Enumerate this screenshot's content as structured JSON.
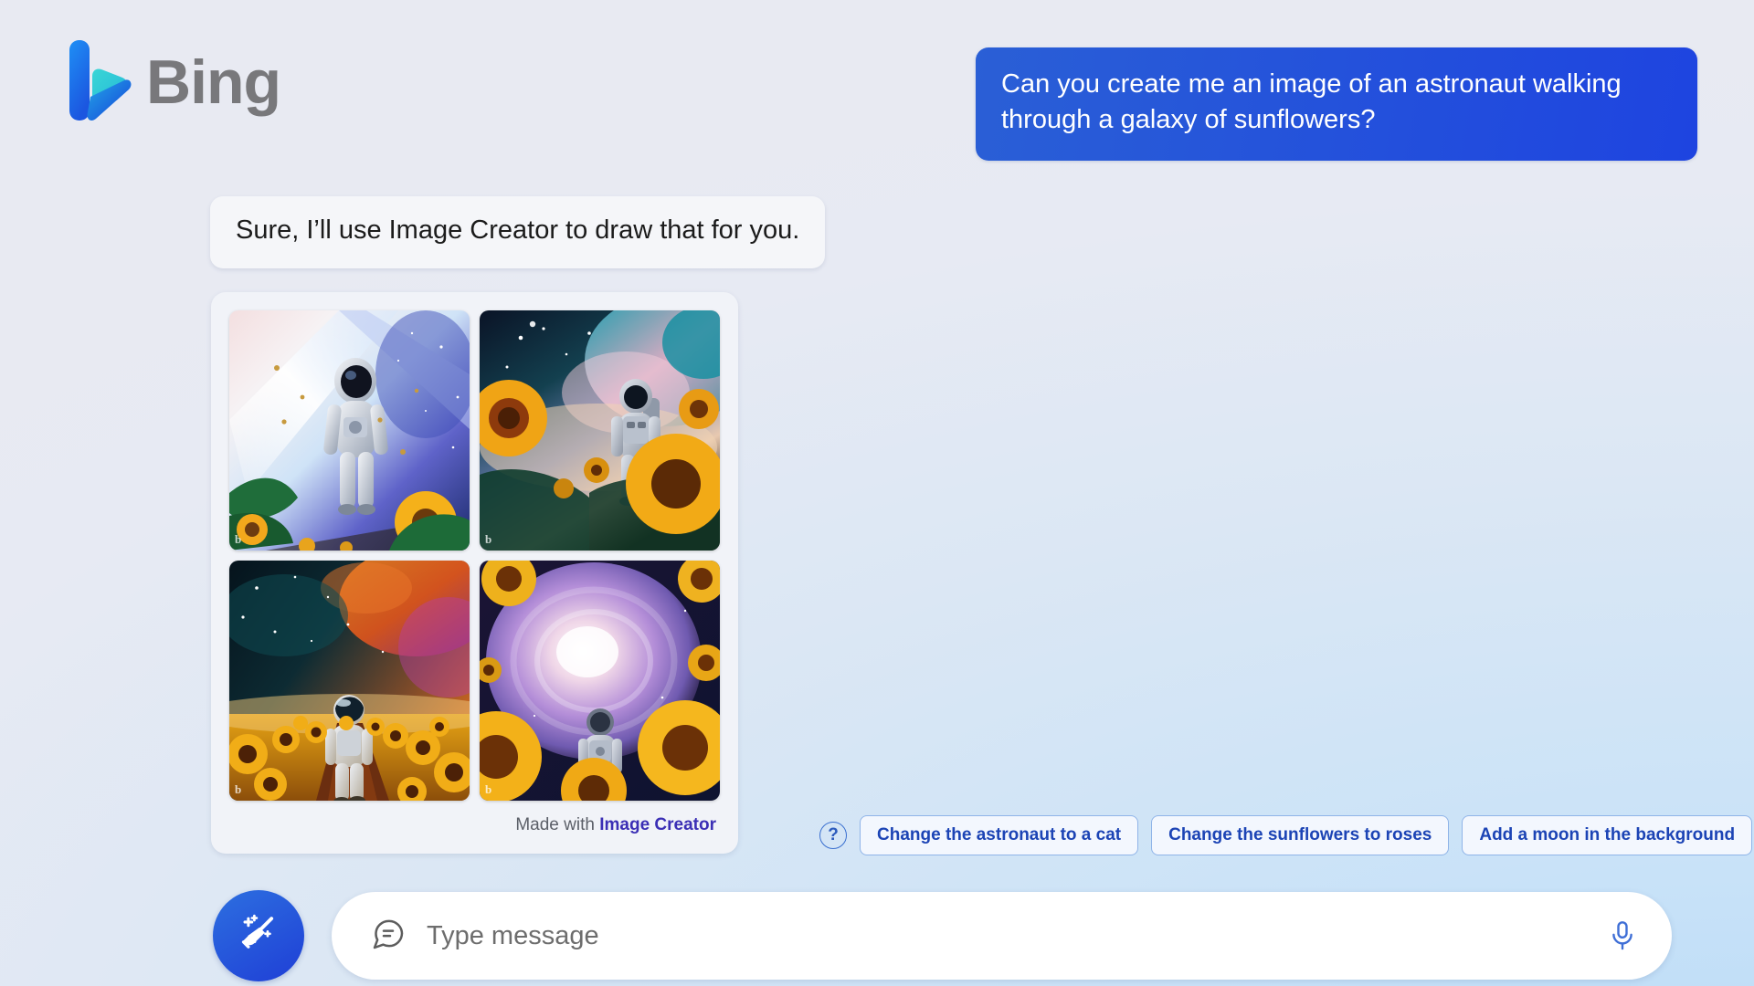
{
  "brand": {
    "name": "Bing",
    "logo_icon": "bing-b-logo-icon",
    "logo_colors": {
      "blue": "#1a7ff0",
      "teal": "#2fd2c8",
      "deep_blue": "#1557d6"
    }
  },
  "conversation": {
    "user_message": "Can you create me an image of an astronaut walking through a galaxy of sunflowers?",
    "bot_message": "Sure, I’ll use Image Creator to draw that for you."
  },
  "image_card": {
    "images": [
      {
        "alt": "Astronaut walking on a path with a bright nebula and sunflowers in the foreground",
        "watermark": "b"
      },
      {
        "alt": "Astronaut walking away through teal and pink galaxy with large sunflowers",
        "watermark": "b"
      },
      {
        "alt": "Astronaut walking through a field of sunflowers under an orange nebula",
        "watermark": "b"
      },
      {
        "alt": "Astronaut walking toward a purple spiral galaxy surrounded by sunflowers",
        "watermark": "b"
      }
    ],
    "footer_prefix": "Made with ",
    "footer_link": "Image Creator",
    "footer_link_color": "#3b2fb5"
  },
  "suggestions": {
    "help_icon": "question-mark-icon",
    "chips": [
      "Change the astronaut to a cat",
      "Change the sunflowers to roses",
      "Add a moon in the background"
    ],
    "chip_text_color": "#1c44b5",
    "chip_border_color": "#8fb4e8"
  },
  "composer": {
    "new_topic_icon": "broom-sparkle-icon",
    "chat_icon": "chat-bubble-lines-icon",
    "placeholder": "Type message",
    "value": "",
    "mic_icon": "microphone-icon",
    "accent_color": "#2257d8"
  }
}
